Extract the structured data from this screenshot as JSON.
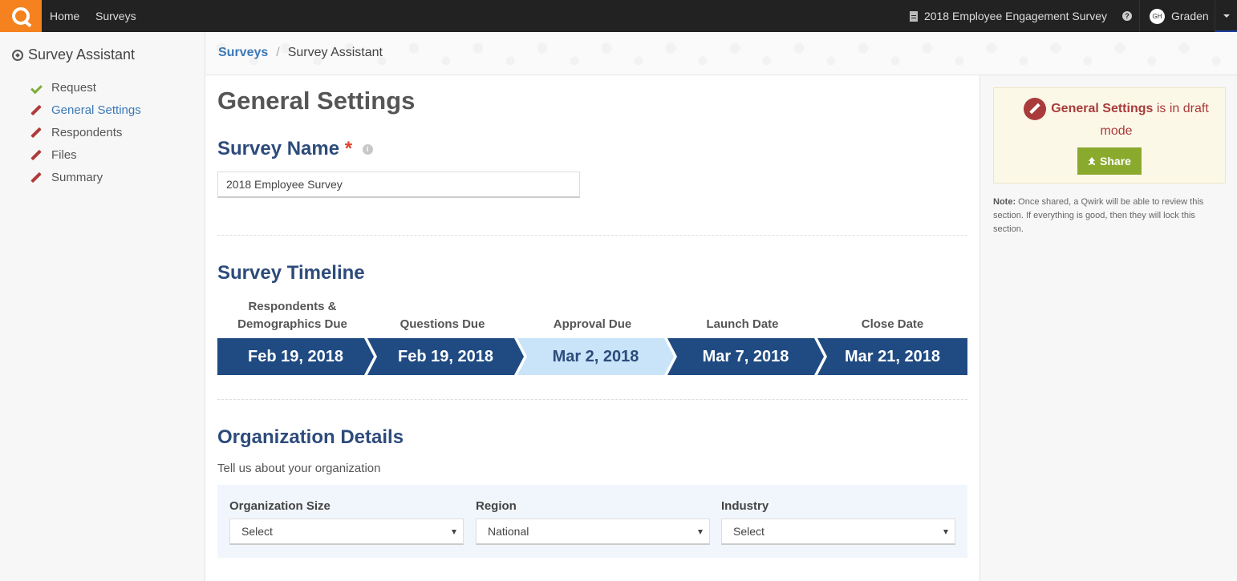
{
  "nav": {
    "home": "Home",
    "surveys": "Surveys",
    "survey_title": "2018 Employee Engagement Survey",
    "user_initials": "GH",
    "user_name": "Graden"
  },
  "sidebar": {
    "title": "Survey Assistant",
    "items": [
      {
        "label": "Request",
        "status": "complete"
      },
      {
        "label": "General Settings",
        "status": "draft"
      },
      {
        "label": "Respondents",
        "status": "draft"
      },
      {
        "label": "Files",
        "status": "draft"
      },
      {
        "label": "Summary",
        "status": "draft"
      }
    ]
  },
  "breadcrumb": {
    "link": "Surveys",
    "separator": "/",
    "current": "Survey Assistant"
  },
  "main": {
    "page_title": "General Settings",
    "survey_name_title": "Survey Name",
    "required_mark": "*",
    "survey_name_value": "2018 Employee Survey",
    "timeline_title": "Survey Timeline",
    "timeline": [
      {
        "label": "Respondents & Demographics Due",
        "date": "Feb 19, 2018",
        "color": "#1f4a82"
      },
      {
        "label": "Questions Due",
        "date": "Feb 19, 2018",
        "color": "#1f4a82"
      },
      {
        "label": "Approval Due",
        "date": "Mar 2, 2018",
        "color": "#c9e3f9"
      },
      {
        "label": "Launch Date",
        "date": "Mar 7, 2018",
        "color": "#1f4a82"
      },
      {
        "label": "Close Date",
        "date": "Mar 21, 2018",
        "color": "#1f4a82"
      }
    ],
    "org_title": "Organization Details",
    "org_subtitle": "Tell us about your organization",
    "org_fields": [
      {
        "label": "Organization Size",
        "value": "Select"
      },
      {
        "label": "Region",
        "value": "National"
      },
      {
        "label": "Industry",
        "value": "Select"
      }
    ]
  },
  "draft_panel": {
    "section": "General Settings",
    "suffix": "is in draft mode",
    "share_label": "Share",
    "note_label": "Note:",
    "note_text": "Once shared, a Qwirk will be able to review this section. If everything is good, then they will lock this section."
  },
  "colors": {
    "accent": "#f5821f",
    "primary": "#1f4a82",
    "link": "#3b79b7",
    "draft": "#a93b3b",
    "share": "#8aaa2e"
  }
}
